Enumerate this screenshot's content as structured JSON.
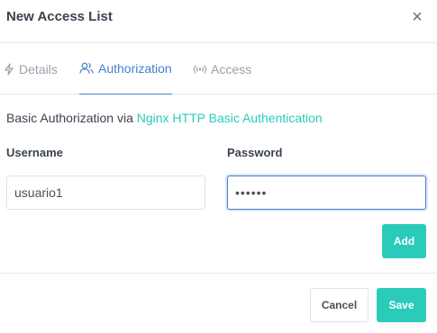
{
  "modal": {
    "title": "New Access List",
    "close_icon": "close-icon",
    "close_glyph": "×"
  },
  "tabs": [
    {
      "label": "Details",
      "icon": "lightning-icon",
      "active": false
    },
    {
      "label": "Authorization",
      "icon": "users-icon",
      "active": true
    },
    {
      "label": "Access",
      "icon": "broadcast-icon",
      "active": false
    }
  ],
  "auth": {
    "intro_text": "Basic Authorization via ",
    "intro_link": "Nginx HTTP Basic Authentication",
    "username_label": "Username",
    "password_label": "Password",
    "username_value": "usuario1",
    "password_value": "••••••"
  },
  "buttons": {
    "add": "Add",
    "cancel": "Cancel",
    "save": "Save"
  },
  "colors": {
    "accent_teal": "#2bcbba",
    "accent_blue": "#467fcf",
    "muted_text": "#9aa0ac"
  }
}
